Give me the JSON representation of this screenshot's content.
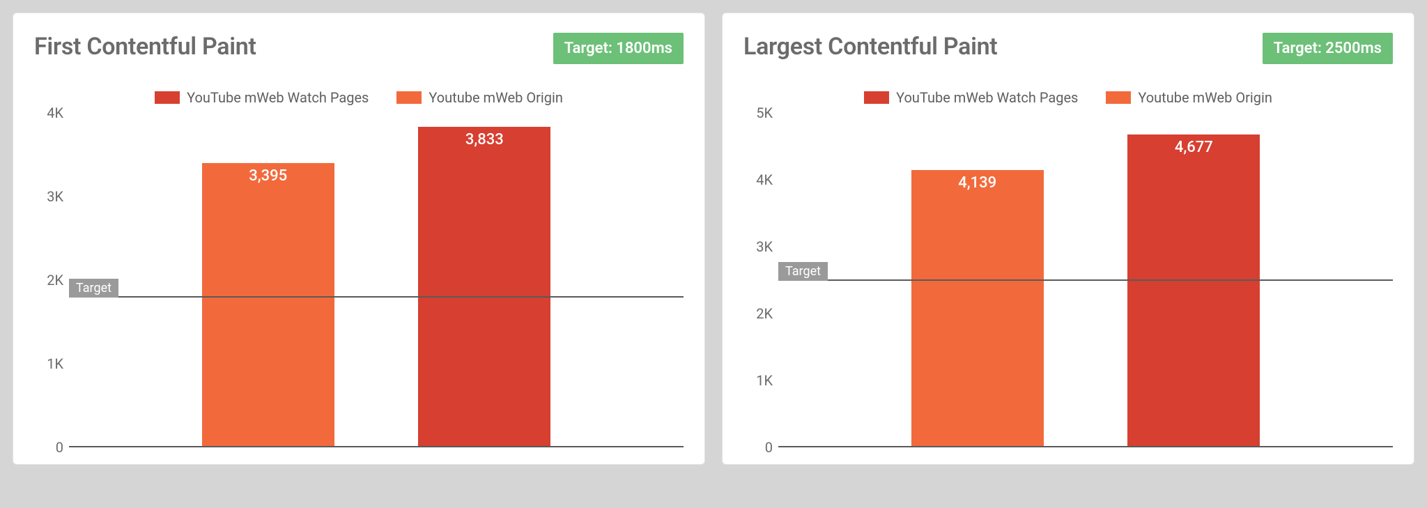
{
  "chart_data": [
    {
      "type": "bar",
      "title": "First Contentful Paint",
      "target_label": "Target: 1800ms",
      "target_value": 1800,
      "ylabel": "",
      "xlabel": "",
      "ylim": [
        0,
        4000
      ],
      "yticks": [
        0,
        1000,
        2000,
        3000,
        4000
      ],
      "ytick_labels": [
        "0",
        "1K",
        "2K",
        "3K",
        "4K"
      ],
      "target_line_text": "Target",
      "series": [
        {
          "name": "YouTube mWeb Watch Pages",
          "color": "#d73f31",
          "legend_order": 0
        },
        {
          "name": "Youtube mWeb Origin",
          "color": "#f26a3c",
          "legend_order": 1
        }
      ],
      "bars": [
        {
          "series": "Youtube mWeb Origin",
          "value": 3395,
          "label": "3,395",
          "color": "#f26a3c"
        },
        {
          "series": "YouTube mWeb Watch Pages",
          "value": 3833,
          "label": "3,833",
          "color": "#d73f31"
        }
      ]
    },
    {
      "type": "bar",
      "title": "Largest Contentful Paint",
      "target_label": "Target: 2500ms",
      "target_value": 2500,
      "ylabel": "",
      "xlabel": "",
      "ylim": [
        0,
        5000
      ],
      "yticks": [
        0,
        1000,
        2000,
        3000,
        4000,
        5000
      ],
      "ytick_labels": [
        "0",
        "1K",
        "2K",
        "3K",
        "4K",
        "5K"
      ],
      "target_line_text": "Target",
      "series": [
        {
          "name": "YouTube mWeb Watch Pages",
          "color": "#d73f31",
          "legend_order": 0
        },
        {
          "name": "Youtube mWeb Origin",
          "color": "#f26a3c",
          "legend_order": 1
        }
      ],
      "bars": [
        {
          "series": "Youtube mWeb Origin",
          "value": 4139,
          "label": "4,139",
          "color": "#f26a3c"
        },
        {
          "series": "YouTube mWeb Watch Pages",
          "value": 4677,
          "label": "4,677",
          "color": "#d73f31"
        }
      ]
    }
  ]
}
